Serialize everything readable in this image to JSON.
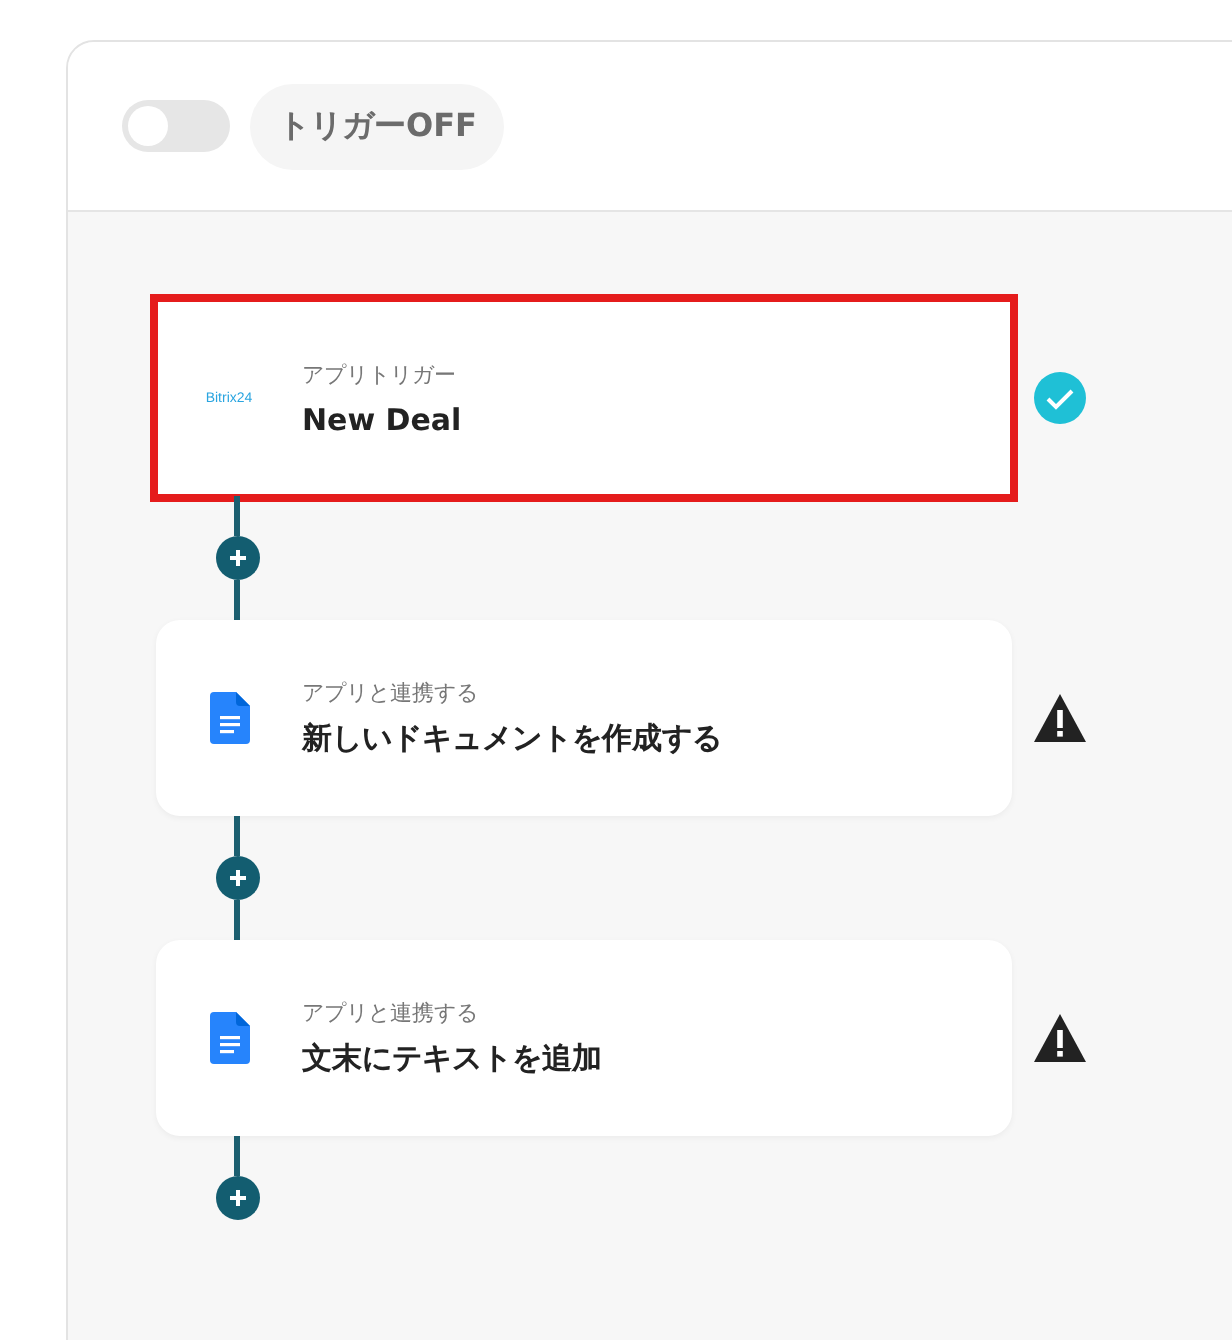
{
  "trigger": {
    "label": "トリガーOFF",
    "on": false
  },
  "steps": [
    {
      "kind": "bitrix",
      "logo_text": "Bitrix24",
      "caption": "アプリトリガー",
      "title": "New Deal",
      "complete": true,
      "selected": true
    },
    {
      "kind": "docs",
      "caption": "アプリと連携する",
      "title": "新しいドキュメントを作成する",
      "complete": false,
      "selected": false
    },
    {
      "kind": "docs",
      "caption": "アプリと連携する",
      "title": "文末にテキストを追加",
      "complete": false,
      "selected": false
    }
  ]
}
